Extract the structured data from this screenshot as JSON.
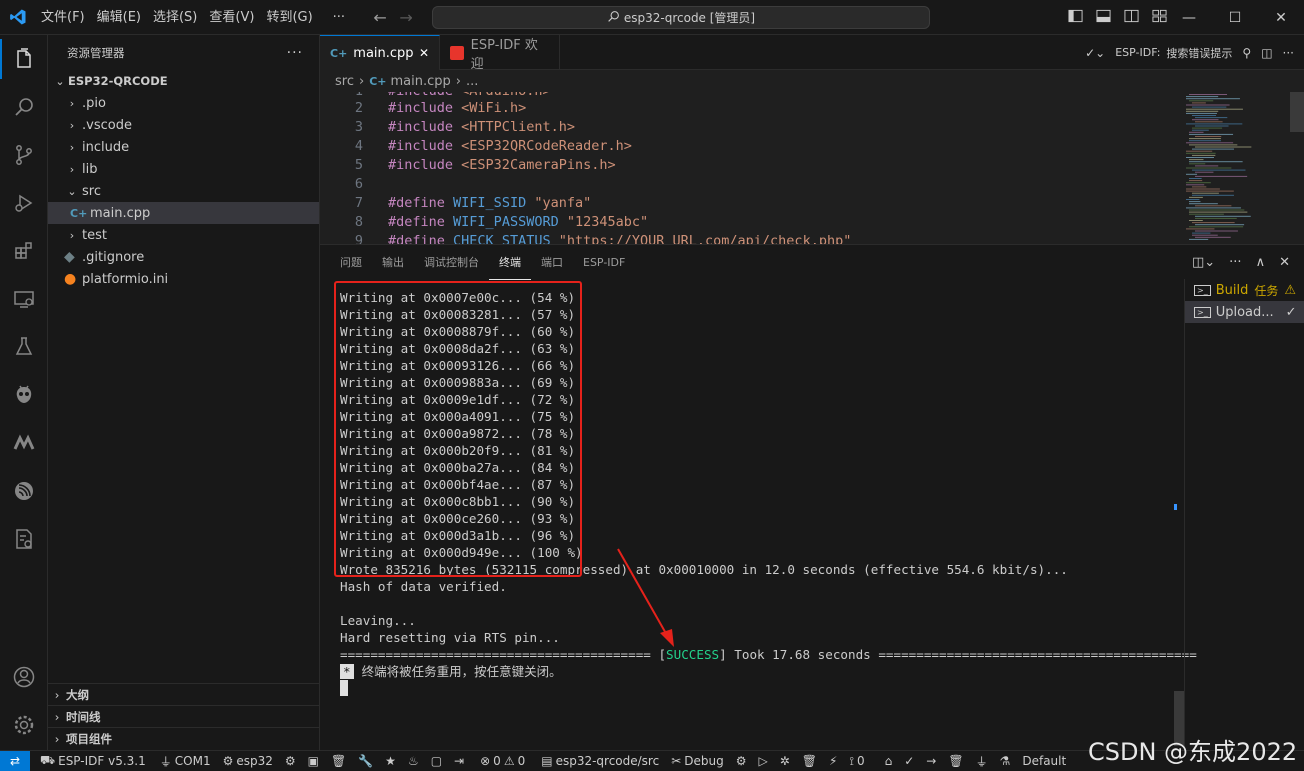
{
  "menu": [
    "文件(F)",
    "编辑(E)",
    "选择(S)",
    "查看(V)",
    "转到(G)",
    "···"
  ],
  "search": {
    "text": "esp32-qrcode [管理员]"
  },
  "sidebar": {
    "title": "资源管理器",
    "project": "ESP32-QRCODE",
    "tree": [
      {
        "label": ".pio",
        "type": "folder"
      },
      {
        "label": ".vscode",
        "type": "folder"
      },
      {
        "label": "include",
        "type": "folder"
      },
      {
        "label": "lib",
        "type": "folder"
      },
      {
        "label": "src",
        "type": "folder-open"
      },
      {
        "label": "main.cpp",
        "type": "file-cpp"
      },
      {
        "label": "test",
        "type": "folder"
      },
      {
        "label": ".gitignore",
        "type": "file"
      },
      {
        "label": "platformio.ini",
        "type": "file-pio"
      }
    ],
    "sections": [
      "大纲",
      "时间线",
      "项目组件"
    ]
  },
  "tabs": [
    {
      "label": "main.cpp",
      "active": true
    },
    {
      "label": "ESP-IDF 欢迎",
      "active": false
    }
  ],
  "toolbar": {
    "espidf_label": "ESP-IDF:",
    "search_error": "搜索错误提示"
  },
  "breadcrumb": [
    "src",
    "main.cpp",
    "..."
  ],
  "code": [
    {
      "n": "1",
      "t": "#include <Arduino.h>"
    },
    {
      "n": "2",
      "t": "#include <WiFi.h>"
    },
    {
      "n": "3",
      "t": "#include <HTTPClient.h>"
    },
    {
      "n": "4",
      "t": "#include <ESP32QRCodeReader.h>"
    },
    {
      "n": "5",
      "t": "#include <ESP32CameraPins.h>"
    },
    {
      "n": "6",
      "t": ""
    },
    {
      "n": "7",
      "t": "#define WIFI_SSID \"yanfa\""
    },
    {
      "n": "8",
      "t": "#define WIFI_PASSWORD \"12345abc\""
    },
    {
      "n": "9",
      "t": "#define CHECK_STATUS \"https://YOUR_URL.com/api/check.php\""
    }
  ],
  "panel": {
    "tabs": [
      "问题",
      "输出",
      "调试控制台",
      "终端",
      "端口",
      "ESP-IDF"
    ],
    "active_tab": "终端",
    "terminal_lines": [
      "Writing at 0x0007e00c... (54 %)",
      "Writing at 0x00083281... (57 %)",
      "Writing at 0x0008879f... (60 %)",
      "Writing at 0x0008da2f... (63 %)",
      "Writing at 0x00093126... (66 %)",
      "Writing at 0x0009883a... (69 %)",
      "Writing at 0x0009e1df... (72 %)",
      "Writing at 0x000a4091... (75 %)",
      "Writing at 0x000a9872... (78 %)",
      "Writing at 0x000b20f9... (81 %)",
      "Writing at 0x000ba27a... (84 %)",
      "Writing at 0x000bf4ae... (87 %)",
      "Writing at 0x000c8bb1... (90 %)",
      "Writing at 0x000ce260... (93 %)",
      "Writing at 0x000d3a1b... (96 %)",
      "Writing at 0x000d949e... (100 %)",
      "Wrote 835216 bytes (532115 compressed) at 0x00010000 in 12.0 seconds (effective 554.6 kbit/s)...",
      "Hash of data verified.",
      "",
      "Leaving...",
      "Hard resetting via RTS pin..."
    ],
    "success_prefix": "========================================= [",
    "success_word": "SUCCESS",
    "success_suffix": "] Took 17.68 seconds ==========================================",
    "reuse_star": "*",
    "reuse_msg": "终端将被任务重用，按任意键关闭。",
    "tasks": [
      {
        "label": "Build",
        "extra": "任务"
      },
      {
        "label": "Upload..."
      }
    ]
  },
  "status": {
    "espidf": "ESP-IDF v5.3.1",
    "com": "COM1",
    "target": "esp32",
    "problems": "0",
    "warnings": "0",
    "path": "esp32-qrcode/src",
    "debug": "Debug",
    "ports": "0",
    "default": "Default"
  },
  "watermark": "CSDN @东成2022",
  "colors": {
    "accent": "#0078d4",
    "success": "#23d18b",
    "highlight_box": "#e5221b",
    "warning": "#cca700"
  }
}
